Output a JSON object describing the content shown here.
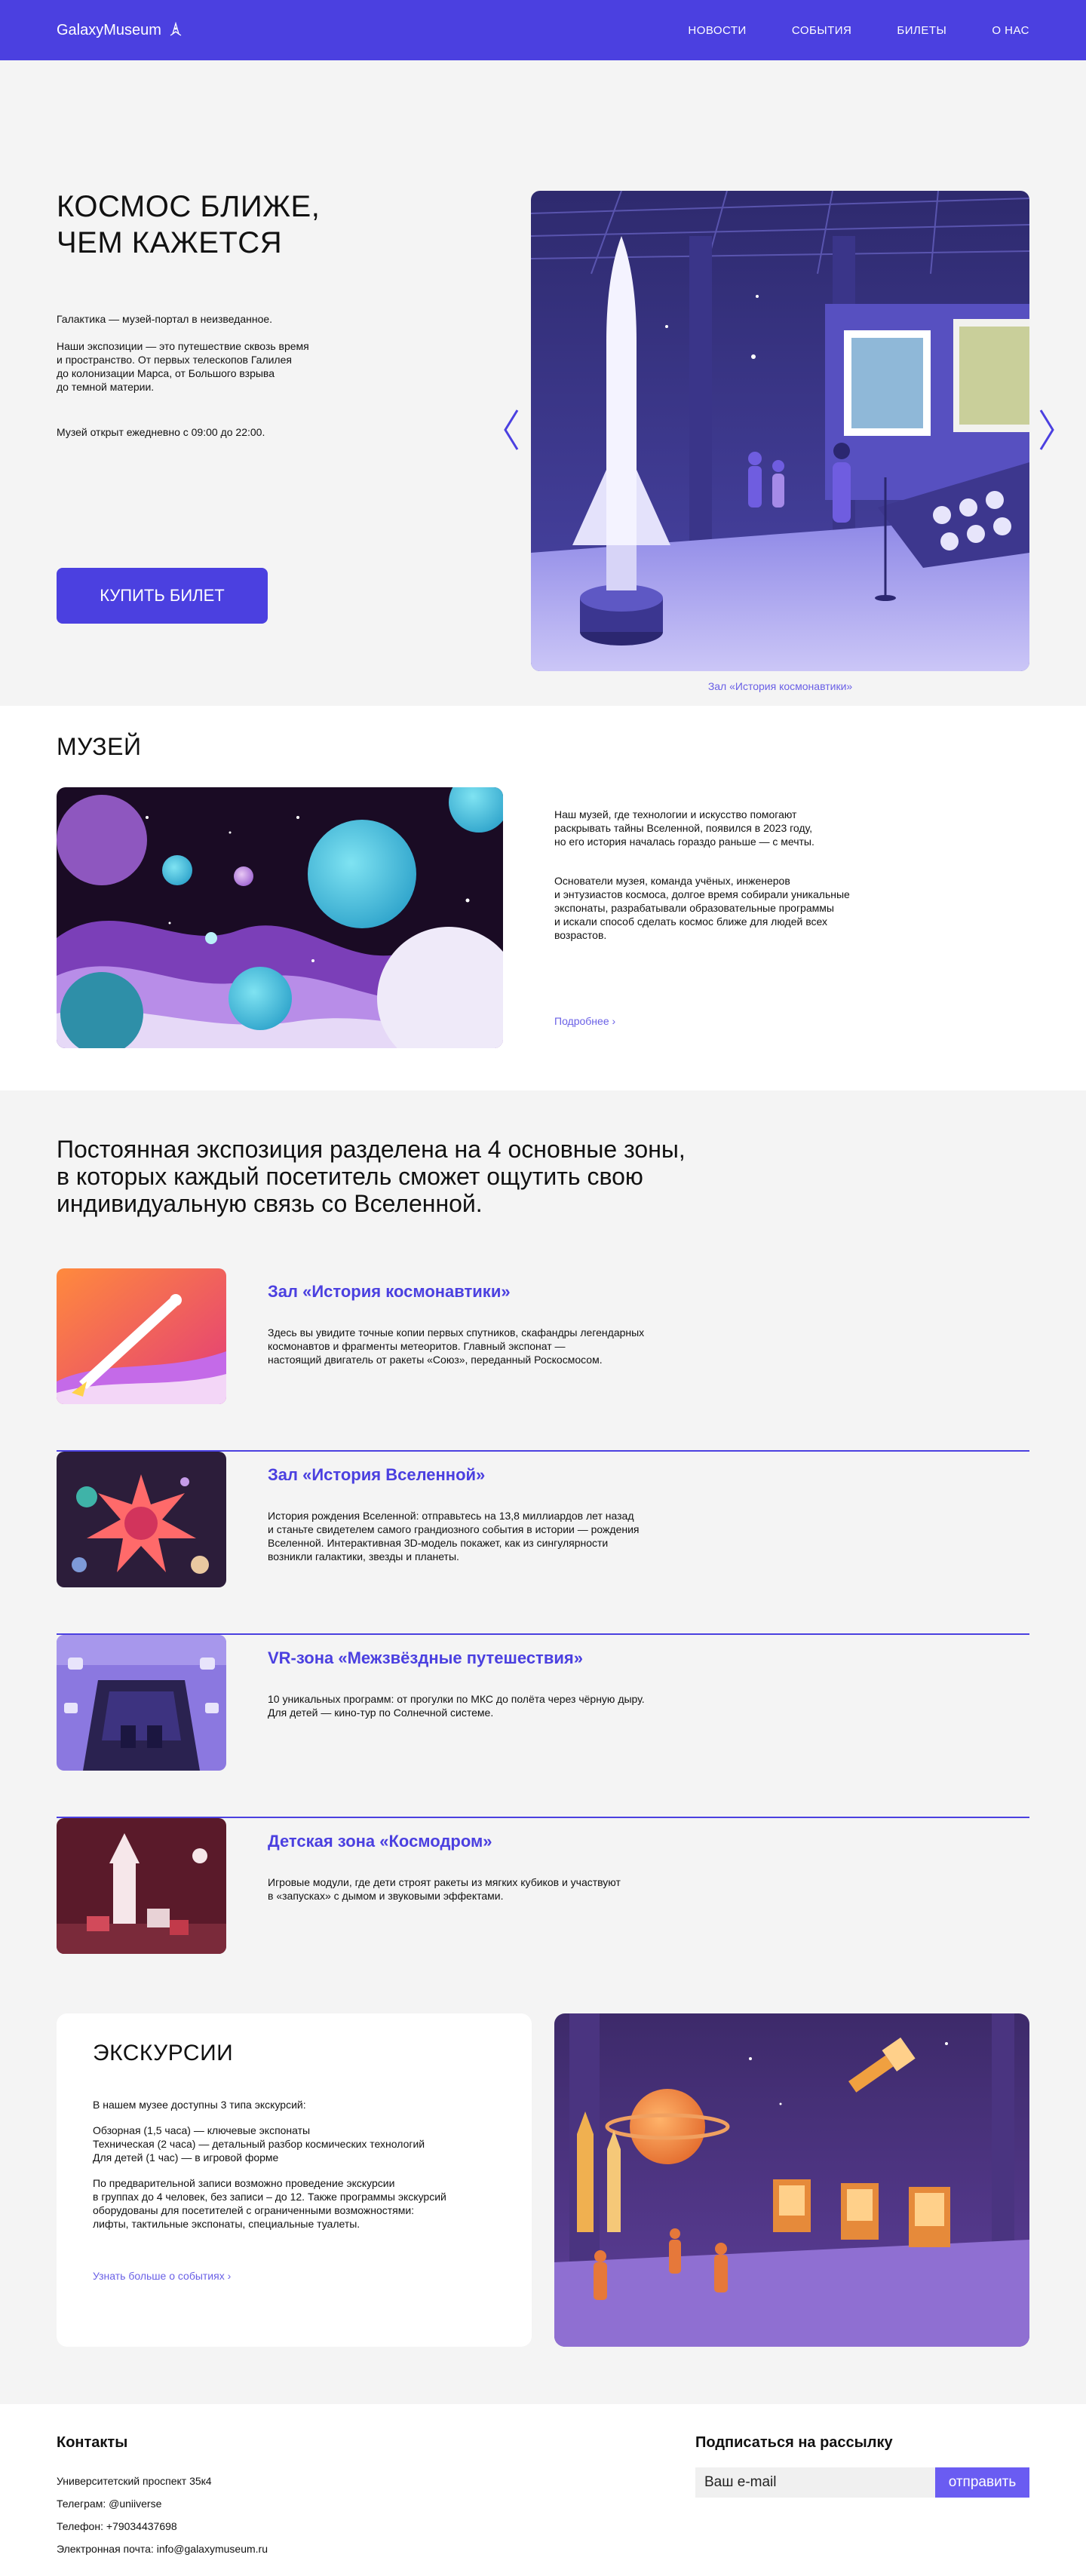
{
  "header": {
    "logo": "GalaxyMuseum",
    "nav": [
      "НОВОСТИ",
      "СОБЫТИЯ",
      "БИЛЕТЫ",
      "О НАС"
    ]
  },
  "hero": {
    "title_line1": "КОСМОС БЛИЖЕ,",
    "title_line2": "ЧЕМ КАЖЕТСЯ",
    "intro": "Галактика — музей-портал в неизведанное.",
    "body": "Наши экспозиции — это путешествие сквозь время\nи пространство. От первых телескопов Галилея\nдо колонизации Марса, от Большого взрыва\nдо темной материи.",
    "hours": "Музей открыт ежедневно с 09:00 до 22:00.",
    "buy_button": "КУПИТЬ БИЛЕТ",
    "caption": "Зал «История космонавтики»"
  },
  "museum": {
    "title": "МУЗЕЙ",
    "p1": "Наш музей, где технологии и искусство помогают\nраскрывать тайны Вселенной, появился в 2023 году,\nно его история началась гораздо раньше — с мечты.",
    "p2": "Основатели музея, команда учёных, инженеров\nи энтузиастов космоса, долгое время собирали уникальные\nэкспонаты, разрабатывали образовательные программы\nи искали способ сделать космос ближе для людей всех\nвозрастов.",
    "more": "Подробнее ›"
  },
  "zones": {
    "title": "Постоянная экспозиция разделена на 4 основные зоны,\nв которых каждый посетитель сможет ощутить свою\nиндивидуальную связь со Вселенной.",
    "items": [
      {
        "title": "Зал «История космонавтики»",
        "desc": "Здесь вы увидите точные копии первых спутников, скафандры легендарных\nкосмонавтов и фрагменты метеоритов. Главный экспонат —\nнастоящий двигатель от ракеты «Союз», переданный Роскосмосом."
      },
      {
        "title": "Зал «История Вселенной»",
        "desc": "История рождения Вселенной: отправьтесь на 13,8 миллиардов лет назад\nи станьте свидетелем самого грандиозного события в истории — рождения\nВселенной. Интерактивная 3D-модель покажет, как из сингулярности\nвозникли галактики, звезды и планеты."
      },
      {
        "title": "VR-зона «Межзвёздные путешествия»",
        "desc": "10 уникальных программ: от прогулки по МКС до полёта через чёрную дыру.\nДля детей — кино-тур по Солнечной системе."
      },
      {
        "title": "Детская зона «Космодром»",
        "desc": "Игровые модули, где дети строят ракеты из мягких кубиков и участвуют\nв «запусках» с дымом и звуковыми эффектами."
      }
    ]
  },
  "excursions": {
    "title": "ЭКСКУРСИИ",
    "p1": "В нашем музее доступны 3 типа экскурсий:",
    "p2": "Обзорная (1,5 часа) — ключевые экспонаты\nТехническая (2 часа) — детальный разбор космических технологий\nДля детей (1 час) — в игровой форме",
    "p3": "По предварительной записи возможно проведение экскурсии\nв группах до 4 человек, без записи – до 12. Также программы экскурсий\nоборудованы для посетителей с ограниченными возможностями:\nлифты, тактильные экспонаты, специальные туалеты.",
    "link": "Узнать больше о событиях ›"
  },
  "footer": {
    "contacts_title": "Контакты",
    "address": "Университетский проспект 35к4",
    "telegram": "Телеграм: @uniiverse",
    "phone": "Телефон: +79034437698",
    "email": "Электронная почта: info@galaxymuseum.ru",
    "subscribe_title": "Подписаться на рассылку",
    "email_placeholder": "Ваш e-mail",
    "send_button": "отправить"
  },
  "colors": {
    "accent": "#4b40e0",
    "link": "#6a60e6",
    "background_gray": "#f4f4f4"
  }
}
